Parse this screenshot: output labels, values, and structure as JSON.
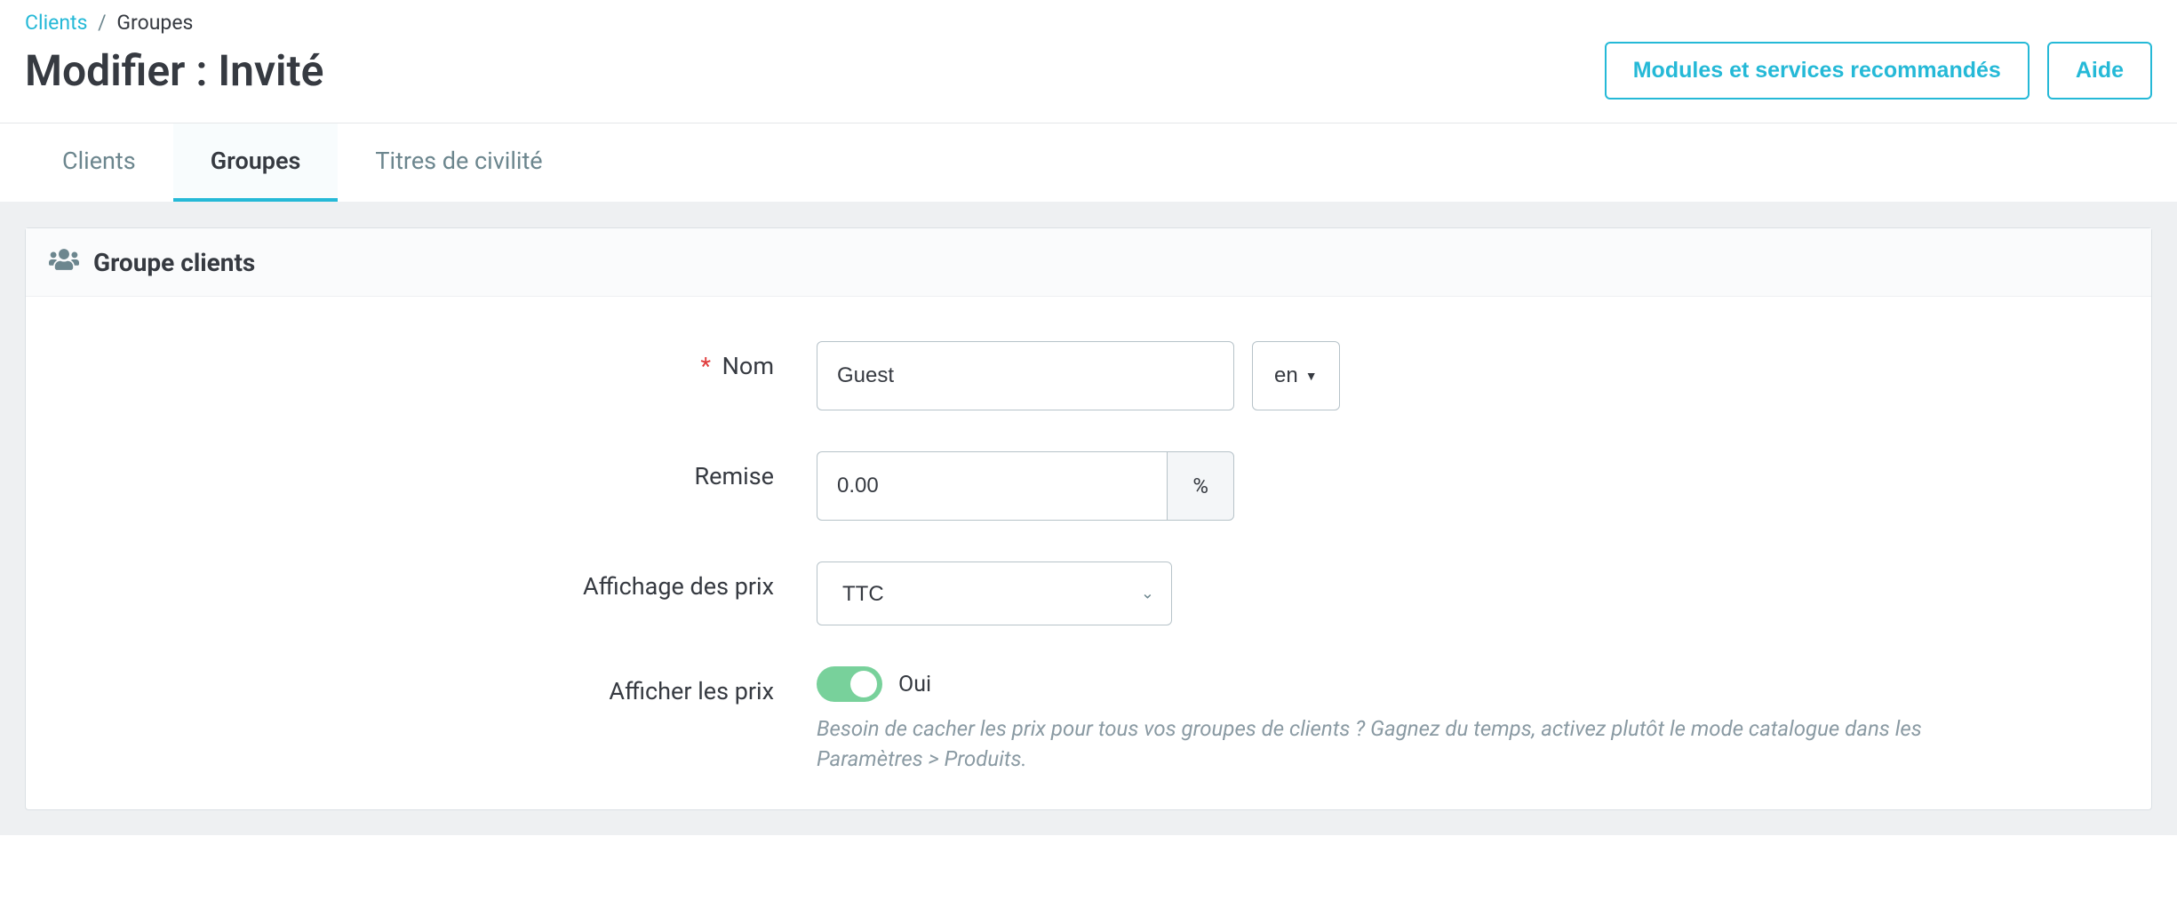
{
  "breadcrumb": {
    "parent": "Clients",
    "current": "Groupes"
  },
  "page_title": "Modifier : Invité",
  "header_buttons": {
    "modules": "Modules et services recommandés",
    "help": "Aide"
  },
  "tabs": {
    "clients": "Clients",
    "groupes": "Groupes",
    "titres": "Titres de civilité"
  },
  "panel": {
    "title": "Groupe clients"
  },
  "form": {
    "name": {
      "label": "Nom",
      "value": "Guest",
      "lang": "en"
    },
    "discount": {
      "label": "Remise",
      "value": "0.00",
      "unit": "%"
    },
    "price_display": {
      "label": "Affichage des prix",
      "value": "TTC"
    },
    "show_prices": {
      "label": "Afficher les prix",
      "value_label": "Oui",
      "help": "Besoin de cacher les prix pour tous vos groupes de clients ? Gagnez du temps, activez plutôt le mode catalogue dans les Paramètres > Produits."
    }
  }
}
